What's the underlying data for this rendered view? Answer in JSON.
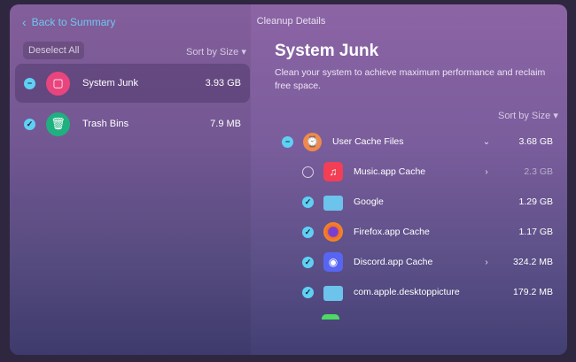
{
  "header": {
    "back_label": "Back to Summary",
    "title": "Cleanup Details"
  },
  "left": {
    "deselect_label": "Deselect All",
    "sort_label": "Sort by Size ▾",
    "items": [
      {
        "name": "System Junk",
        "size": "3.93 GB",
        "state": "partial"
      },
      {
        "name": "Trash Bins",
        "size": "7.9 MB",
        "state": "checked"
      }
    ]
  },
  "main": {
    "title": "System Junk",
    "description": "Clean your system to achieve maximum performance and reclaim free space.",
    "sort_label": "Sort by Size ▾",
    "group": {
      "name": "User Cache Files",
      "size": "3.68 GB"
    },
    "items": [
      {
        "name": "Music.app Cache",
        "size": "2.3 GB"
      },
      {
        "name": "Google",
        "size": "1.29 GB"
      },
      {
        "name": "Firefox.app Cache",
        "size": "1.17 GB"
      },
      {
        "name": "Discord.app Cache",
        "size": "324.2 MB"
      },
      {
        "name": "com.apple.desktoppicture",
        "size": "179.2 MB"
      }
    ]
  },
  "colors": {
    "accent": "#5fd0f5",
    "link": "#6fc8f0"
  }
}
